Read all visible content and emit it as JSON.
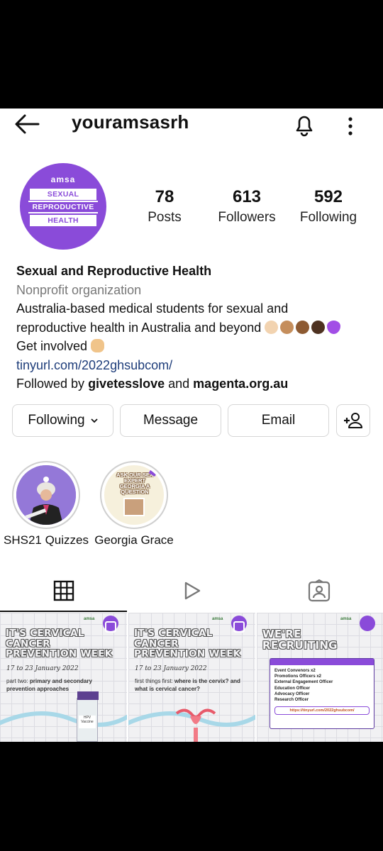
{
  "header": {
    "username": "youramsasrh"
  },
  "profile": {
    "avatar_text": {
      "brand": "amsa",
      "line1": "SEXUAL",
      "line2": "REPRODUCTIVE",
      "line3": "HEALTH"
    },
    "stats": [
      {
        "value": "78",
        "label": "Posts"
      },
      {
        "value": "613",
        "label": "Followers"
      },
      {
        "value": "592",
        "label": "Following"
      }
    ]
  },
  "bio": {
    "name": "Sexual and Reproductive Health",
    "category": "Nonprofit organization",
    "line1": "Australia-based medical students for sexual and",
    "line2": "reproductive health in Australia and beyond",
    "line3": "Get involved",
    "link": "tinyurl.com/2022ghsubcom/",
    "followed_prefix": "Followed by ",
    "followed_user1": "givetesslove",
    "followed_and": " and ",
    "followed_user2": "magenta.org.au"
  },
  "actions": {
    "following": "Following",
    "message": "Message",
    "email": "Email"
  },
  "highlights": [
    {
      "label": "SHS21 Quizzes"
    },
    {
      "label": "Georgia Grace",
      "cover_text": "ASK OUR SEX EXPERT GEORGIA A QUESTION"
    }
  ],
  "tabs": [
    "grid",
    "reels",
    "tagged"
  ],
  "posts": [
    {
      "title": "IT'S CERVICAL CANCER PREVENTION WEEK",
      "dates": "17 to 23 January 2022",
      "subtitle_plain": "part two: ",
      "subtitle_bold": "primary and secondary prevention approaches"
    },
    {
      "title": "IT'S CERVICAL CANCER PREVENTION WEEK",
      "dates": "17 to 23 January 2022",
      "subtitle_plain": "first things first: ",
      "subtitle_bold": "where is the cervix? and what is cervical cancer?"
    },
    {
      "title": "WE'RE RECRUITING",
      "roles": [
        "Event Convenors x2",
        "Promotions Officers x2",
        "External Engagement Officer",
        "Education Officer",
        "Advocacy Officer",
        "Research Officer"
      ],
      "link": "https://tinyurl.com/2022ghsubcom/"
    }
  ],
  "colors": {
    "brand_purple": "#8a4bd9",
    "link_blue": "#1e3d7a",
    "category_gray": "#777777"
  }
}
